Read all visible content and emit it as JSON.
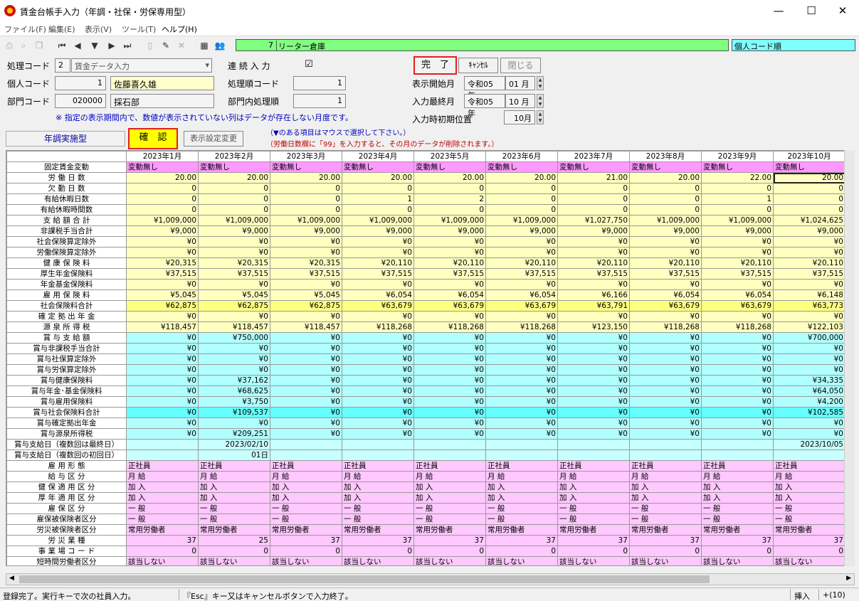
{
  "window": {
    "title": "賃金台帳手入力（年調・社保・労保専用型）",
    "minimize": "—",
    "maximize": "☐",
    "close": "✕"
  },
  "menu": [
    "ファイル(F)",
    "編集(E)",
    "表示(V)",
    "ツール(T)",
    "ヘルプ(H)"
  ],
  "header": {
    "record_num": "7",
    "company": "リーター倉庫",
    "sort_order": "個人コード順"
  },
  "form": {
    "process_code_label": "処理コード",
    "process_code": "2",
    "process_name": "賃金データ入力",
    "continuous_label": "連 続 入 力",
    "continuous_check": "☑",
    "personal_code_label": "個人コード",
    "personal_code": "1",
    "personal_name": "佐藤喜久雄",
    "proc_order_label": "処理順コード",
    "proc_order": "1",
    "dept_code_label": "部門コード",
    "dept_code": "020000",
    "dept_name": "採石部",
    "dept_order_label": "部門内処理順",
    "dept_order": "1",
    "notice": "※ 指定の表示期間内で、数値が表示されていない列はデータが存在しない月度です。",
    "display_start_label": "表示開始月",
    "display_start_era": "令和05 年",
    "display_start_month": "01 月",
    "input_last_label": "入力最終月",
    "input_last_era": "令和05 年",
    "input_last_month": "10 月",
    "input_init_label": "入力時初期位置",
    "input_init": "10月",
    "done_button": "完　了",
    "cancel_button": "ｷｬﾝｾﾙ",
    "close_button": "閉じる",
    "nencho_button": "年調実施型",
    "confirm_button": "確　認",
    "display_settings_button": "表示設定変更",
    "hint1": "（▼のある項目はマウスで選択して下さい。）",
    "hint2": "（労働日数欄に「99」を入力すると、その月のデータが削除されます。）"
  },
  "grid": {
    "months": [
      "2023年1月",
      "2023年2月",
      "2023年3月",
      "2023年4月",
      "2023年5月",
      "2023年6月",
      "2023年7月",
      "2023年8月",
      "2023年9月",
      "2023年10月"
    ],
    "rows": [
      {
        "label": "固定賃金変動",
        "style": "pk",
        "align": "left",
        "values": [
          "変動無し",
          "変動無し",
          "変動無し",
          "変動無し",
          "変動無し",
          "変動無し",
          "変動無し",
          "変動無し",
          "変動無し",
          "変動無し"
        ]
      },
      {
        "label": "労 働 日 数",
        "style": "ye",
        "values": [
          "20.00",
          "20.00",
          "20.00",
          "20.00",
          "20.00",
          "20.00",
          "21.00",
          "20.00",
          "22.00",
          "20.00"
        ]
      },
      {
        "label": "欠 勤 日 数",
        "style": "ye",
        "values": [
          "0",
          "0",
          "0",
          "0",
          "0",
          "0",
          "0",
          "0",
          "0",
          "0"
        ]
      },
      {
        "label": "有給休暇日数",
        "style": "ye",
        "values": [
          "0",
          "0",
          "0",
          "1",
          "2",
          "0",
          "0",
          "0",
          "1",
          "0"
        ]
      },
      {
        "label": "有給休暇時間数",
        "style": "ye",
        "values": [
          "0",
          "0",
          "0",
          "0",
          "0",
          "0",
          "0",
          "0",
          "0",
          "0"
        ]
      },
      {
        "label": "支 給 額 合 計",
        "style": "ye",
        "values": [
          "¥1,009,000",
          "¥1,009,000",
          "¥1,009,000",
          "¥1,009,000",
          "¥1,009,000",
          "¥1,009,000",
          "¥1,027,750",
          "¥1,009,000",
          "¥1,009,000",
          "¥1,024,625"
        ]
      },
      {
        "label": "非課税手当合計",
        "style": "ye",
        "values": [
          "¥9,000",
          "¥9,000",
          "¥9,000",
          "¥9,000",
          "¥9,000",
          "¥9,000",
          "¥9,000",
          "¥9,000",
          "¥9,000",
          "¥9,000"
        ]
      },
      {
        "label": "社会保険算定除外",
        "style": "ye",
        "values": [
          "¥0",
          "¥0",
          "¥0",
          "¥0",
          "¥0",
          "¥0",
          "¥0",
          "¥0",
          "¥0",
          "¥0"
        ]
      },
      {
        "label": "労働保険算定除外",
        "style": "ye",
        "values": [
          "¥0",
          "¥0",
          "¥0",
          "¥0",
          "¥0",
          "¥0",
          "¥0",
          "¥0",
          "¥0",
          "¥0"
        ]
      },
      {
        "label": "健 康 保 険 料",
        "style": "ye",
        "values": [
          "¥20,315",
          "¥20,315",
          "¥20,315",
          "¥20,110",
          "¥20,110",
          "¥20,110",
          "¥20,110",
          "¥20,110",
          "¥20,110",
          "¥20,110"
        ]
      },
      {
        "label": "厚生年金保険料",
        "style": "ye",
        "values": [
          "¥37,515",
          "¥37,515",
          "¥37,515",
          "¥37,515",
          "¥37,515",
          "¥37,515",
          "¥37,515",
          "¥37,515",
          "¥37,515",
          "¥37,515"
        ]
      },
      {
        "label": "年金基金保険料",
        "style": "ye",
        "values": [
          "¥0",
          "¥0",
          "¥0",
          "¥0",
          "¥0",
          "¥0",
          "¥0",
          "¥0",
          "¥0",
          "¥0"
        ]
      },
      {
        "label": "雇 用 保 険 料",
        "style": "ye",
        "values": [
          "¥5,045",
          "¥5,045",
          "¥5,045",
          "¥6,054",
          "¥6,054",
          "¥6,054",
          "¥6,166",
          "¥6,054",
          "¥6,054",
          "¥6,148"
        ]
      },
      {
        "label": "社会保険料合計",
        "style": "yd",
        "values": [
          "¥62,875",
          "¥62,875",
          "¥62,875",
          "¥63,679",
          "¥63,679",
          "¥63,679",
          "¥63,791",
          "¥63,679",
          "¥63,679",
          "¥63,773"
        ]
      },
      {
        "label": "確 定 拠 出 年 金",
        "style": "ye",
        "values": [
          "¥0",
          "¥0",
          "¥0",
          "¥0",
          "¥0",
          "¥0",
          "¥0",
          "¥0",
          "¥0",
          "¥0"
        ]
      },
      {
        "label": "源 泉 所 得 税",
        "style": "ye",
        "values": [
          "¥118,457",
          "¥118,457",
          "¥118,457",
          "¥118,268",
          "¥118,268",
          "¥118,268",
          "¥123,150",
          "¥118,268",
          "¥118,268",
          "¥122,103"
        ]
      },
      {
        "label": "賞 与 支 給 額",
        "style": "cy",
        "values": [
          "¥0",
          "¥750,000",
          "¥0",
          "¥0",
          "¥0",
          "¥0",
          "¥0",
          "¥0",
          "¥0",
          "¥700,000"
        ]
      },
      {
        "label": "賞与非課税手当合計",
        "style": "cy",
        "values": [
          "¥0",
          "¥0",
          "¥0",
          "¥0",
          "¥0",
          "¥0",
          "¥0",
          "¥0",
          "¥0",
          "¥0"
        ]
      },
      {
        "label": "賞与社保算定除外",
        "style": "cy",
        "values": [
          "¥0",
          "¥0",
          "¥0",
          "¥0",
          "¥0",
          "¥0",
          "¥0",
          "¥0",
          "¥0",
          "¥0"
        ]
      },
      {
        "label": "賞与労保算定除外",
        "style": "cy",
        "values": [
          "¥0",
          "¥0",
          "¥0",
          "¥0",
          "¥0",
          "¥0",
          "¥0",
          "¥0",
          "¥0",
          "¥0"
        ]
      },
      {
        "label": "賞与健康保険料",
        "style": "cy",
        "values": [
          "¥0",
          "¥37,162",
          "¥0",
          "¥0",
          "¥0",
          "¥0",
          "¥0",
          "¥0",
          "¥0",
          "¥34,335"
        ]
      },
      {
        "label": "賞与年金･基金保険料",
        "style": "cy",
        "values": [
          "¥0",
          "¥68,625",
          "¥0",
          "¥0",
          "¥0",
          "¥0",
          "¥0",
          "¥0",
          "¥0",
          "¥64,050"
        ]
      },
      {
        "label": "賞与雇用保険料",
        "style": "cy",
        "values": [
          "¥0",
          "¥3,750",
          "¥0",
          "¥0",
          "¥0",
          "¥0",
          "¥0",
          "¥0",
          "¥0",
          "¥4,200"
        ]
      },
      {
        "label": "賞与社会保険料合計",
        "style": "cd",
        "values": [
          "¥0",
          "¥109,537",
          "¥0",
          "¥0",
          "¥0",
          "¥0",
          "¥0",
          "¥0",
          "¥0",
          "¥102,585"
        ]
      },
      {
        "label": "賞与確定拠出年金",
        "style": "cy",
        "values": [
          "¥0",
          "¥0",
          "¥0",
          "¥0",
          "¥0",
          "¥0",
          "¥0",
          "¥0",
          "¥0",
          "¥0"
        ]
      },
      {
        "label": "賞与源泉所得税",
        "style": "cy",
        "values": [
          "¥0",
          "¥209,251",
          "¥0",
          "¥0",
          "¥0",
          "¥0",
          "¥0",
          "¥0",
          "¥0",
          "¥0"
        ]
      },
      {
        "label": "賞与支給日（複数回は最終日）",
        "style": "lc",
        "values": [
          "",
          "2023/02/10",
          "",
          "",
          "",
          "",
          "",
          "",
          "",
          "2023/10/05"
        ]
      },
      {
        "label": "賞与支給日（複数回の初回日）",
        "style": "lc",
        "values": [
          "",
          "01日",
          "",
          "",
          "",
          "",
          "",
          "",
          "",
          ""
        ]
      },
      {
        "label": "雇 用 形 態",
        "style": "pi",
        "align": "left",
        "values": [
          "正社員",
          "正社員",
          "正社員",
          "正社員",
          "正社員",
          "正社員",
          "正社員",
          "正社員",
          "正社員",
          "正社員"
        ]
      },
      {
        "label": "給 与 区 分",
        "style": "pi",
        "align": "left",
        "values": [
          "月 給",
          "月 給",
          "月 給",
          "月 給",
          "月 給",
          "月 給",
          "月 給",
          "月 給",
          "月 給",
          "月 給"
        ]
      },
      {
        "label": "健 保 適 用 区 分",
        "style": "pi",
        "align": "left",
        "values": [
          "加 入",
          "加 入",
          "加 入",
          "加 入",
          "加 入",
          "加 入",
          "加 入",
          "加 入",
          "加 入",
          "加 入"
        ]
      },
      {
        "label": "厚 年 適 用 区 分",
        "style": "pi",
        "align": "left",
        "values": [
          "加 入",
          "加 入",
          "加 入",
          "加 入",
          "加 入",
          "加 入",
          "加 入",
          "加 入",
          "加 入",
          "加 入"
        ]
      },
      {
        "label": "雇 保 区 分",
        "style": "pi",
        "align": "left",
        "values": [
          "一 般",
          "一 般",
          "一 般",
          "一 般",
          "一 般",
          "一 般",
          "一 般",
          "一 般",
          "一 般",
          "一 般"
        ]
      },
      {
        "label": "雇保被保険者区分",
        "style": "pi",
        "align": "left",
        "values": [
          "一 般",
          "一 般",
          "一 般",
          "一 般",
          "一 般",
          "一 般",
          "一 般",
          "一 般",
          "一 般",
          "一 般"
        ]
      },
      {
        "label": "労災被保険者区分",
        "style": "pi",
        "align": "left",
        "values": [
          "常用労働者",
          "常用労働者",
          "常用労働者",
          "常用労働者",
          "常用労働者",
          "常用労働者",
          "常用労働者",
          "常用労働者",
          "常用労働者",
          "常用労働者"
        ]
      },
      {
        "label": "労 災 業 種",
        "style": "pi",
        "values": [
          "37",
          "25",
          "37",
          "37",
          "37",
          "37",
          "37",
          "37",
          "37",
          "37"
        ]
      },
      {
        "label": "事 業 場 コ ー ド",
        "style": "pi",
        "values": [
          "0",
          "0",
          "0",
          "0",
          "0",
          "0",
          "0",
          "0",
          "0",
          "0"
        ]
      },
      {
        "label": "短時間労働者区分",
        "style": "pi",
        "align": "left",
        "values": [
          "該当しない",
          "該当しない",
          "該当しない",
          "該当しない",
          "該当しない",
          "該当しない",
          "該当しない",
          "該当しない",
          "該当しない",
          "該当しない"
        ]
      }
    ]
  },
  "status": {
    "message": "登録完了。実行キーで次の社員入力。",
    "hint": "『Esc』キー又はキャンセルボタンで入力終了。",
    "mode": "挿入",
    "count": "+(10)"
  }
}
